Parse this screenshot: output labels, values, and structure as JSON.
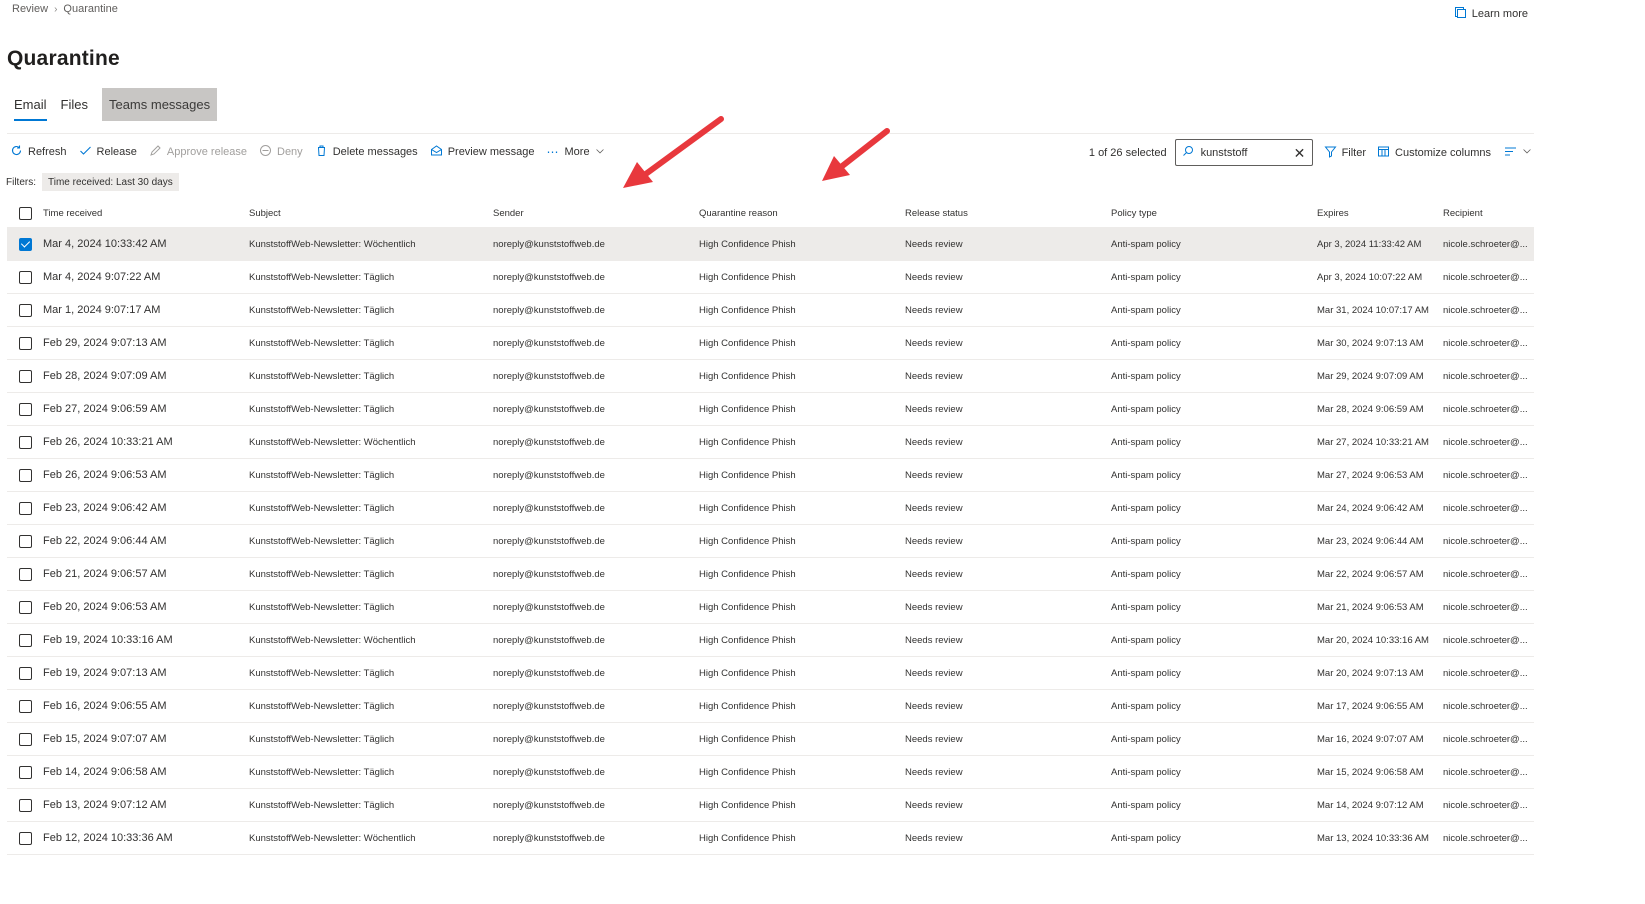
{
  "breadcrumb": {
    "items": [
      "Review",
      "Quarantine"
    ]
  },
  "header": {
    "learn_more": "Learn more"
  },
  "page_title": "Quarantine",
  "tabs": [
    {
      "label": "Email",
      "active": true
    },
    {
      "label": "Files",
      "active": false
    },
    {
      "label": "Teams messages",
      "active": false
    }
  ],
  "toolbar": {
    "refresh": "Refresh",
    "release": "Release",
    "approve_release": "Approve release",
    "deny": "Deny",
    "delete_messages": "Delete messages",
    "preview_message": "Preview message",
    "more": "More",
    "selected_count": "1 of 26 selected",
    "filter": "Filter",
    "customize_columns": "Customize columns"
  },
  "search": {
    "value": "kunststoff"
  },
  "filters": {
    "label": "Filters:",
    "chip": "Time received: Last 30 days"
  },
  "table": {
    "columns": [
      "Time received",
      "Subject",
      "Sender",
      "Quarantine reason",
      "Release status",
      "Policy type",
      "Expires",
      "Recipient"
    ],
    "rows": [
      {
        "selected": true,
        "time": "Mar 4, 2024 10:33:42 AM",
        "subject": "KunststoffWeb-Newsletter: Wöchentlich",
        "sender": "noreply@kunststoffweb.de",
        "reason": "High Confidence Phish",
        "status": "Needs review",
        "policy": "Anti-spam policy",
        "expires": "Apr 3, 2024 11:33:42 AM",
        "recipient": "nicole.schroeter@..."
      },
      {
        "selected": false,
        "time": "Mar 4, 2024 9:07:22 AM",
        "subject": "KunststoffWeb-Newsletter: Täglich",
        "sender": "noreply@kunststoffweb.de",
        "reason": "High Confidence Phish",
        "status": "Needs review",
        "policy": "Anti-spam policy",
        "expires": "Apr 3, 2024 10:07:22 AM",
        "recipient": "nicole.schroeter@..."
      },
      {
        "selected": false,
        "time": "Mar 1, 2024 9:07:17 AM",
        "subject": "KunststoffWeb-Newsletter: Täglich",
        "sender": "noreply@kunststoffweb.de",
        "reason": "High Confidence Phish",
        "status": "Needs review",
        "policy": "Anti-spam policy",
        "expires": "Mar 31, 2024 10:07:17 AM",
        "recipient": "nicole.schroeter@..."
      },
      {
        "selected": false,
        "time": "Feb 29, 2024 9:07:13 AM",
        "subject": "KunststoffWeb-Newsletter: Täglich",
        "sender": "noreply@kunststoffweb.de",
        "reason": "High Confidence Phish",
        "status": "Needs review",
        "policy": "Anti-spam policy",
        "expires": "Mar 30, 2024 9:07:13 AM",
        "recipient": "nicole.schroeter@..."
      },
      {
        "selected": false,
        "time": "Feb 28, 2024 9:07:09 AM",
        "subject": "KunststoffWeb-Newsletter: Täglich",
        "sender": "noreply@kunststoffweb.de",
        "reason": "High Confidence Phish",
        "status": "Needs review",
        "policy": "Anti-spam policy",
        "expires": "Mar 29, 2024 9:07:09 AM",
        "recipient": "nicole.schroeter@..."
      },
      {
        "selected": false,
        "time": "Feb 27, 2024 9:06:59 AM",
        "subject": "KunststoffWeb-Newsletter: Täglich",
        "sender": "noreply@kunststoffweb.de",
        "reason": "High Confidence Phish",
        "status": "Needs review",
        "policy": "Anti-spam policy",
        "expires": "Mar 28, 2024 9:06:59 AM",
        "recipient": "nicole.schroeter@..."
      },
      {
        "selected": false,
        "time": "Feb 26, 2024 10:33:21 AM",
        "subject": "KunststoffWeb-Newsletter: Wöchentlich",
        "sender": "noreply@kunststoffweb.de",
        "reason": "High Confidence Phish",
        "status": "Needs review",
        "policy": "Anti-spam policy",
        "expires": "Mar 27, 2024 10:33:21 AM",
        "recipient": "nicole.schroeter@..."
      },
      {
        "selected": false,
        "time": "Feb 26, 2024 9:06:53 AM",
        "subject": "KunststoffWeb-Newsletter: Täglich",
        "sender": "noreply@kunststoffweb.de",
        "reason": "High Confidence Phish",
        "status": "Needs review",
        "policy": "Anti-spam policy",
        "expires": "Mar 27, 2024 9:06:53 AM",
        "recipient": "nicole.schroeter@..."
      },
      {
        "selected": false,
        "time": "Feb 23, 2024 9:06:42 AM",
        "subject": "KunststoffWeb-Newsletter: Täglich",
        "sender": "noreply@kunststoffweb.de",
        "reason": "High Confidence Phish",
        "status": "Needs review",
        "policy": "Anti-spam policy",
        "expires": "Mar 24, 2024 9:06:42 AM",
        "recipient": "nicole.schroeter@..."
      },
      {
        "selected": false,
        "time": "Feb 22, 2024 9:06:44 AM",
        "subject": "KunststoffWeb-Newsletter: Täglich",
        "sender": "noreply@kunststoffweb.de",
        "reason": "High Confidence Phish",
        "status": "Needs review",
        "policy": "Anti-spam policy",
        "expires": "Mar 23, 2024 9:06:44 AM",
        "recipient": "nicole.schroeter@..."
      },
      {
        "selected": false,
        "time": "Feb 21, 2024 9:06:57 AM",
        "subject": "KunststoffWeb-Newsletter: Täglich",
        "sender": "noreply@kunststoffweb.de",
        "reason": "High Confidence Phish",
        "status": "Needs review",
        "policy": "Anti-spam policy",
        "expires": "Mar 22, 2024 9:06:57 AM",
        "recipient": "nicole.schroeter@..."
      },
      {
        "selected": false,
        "time": "Feb 20, 2024 9:06:53 AM",
        "subject": "KunststoffWeb-Newsletter: Täglich",
        "sender": "noreply@kunststoffweb.de",
        "reason": "High Confidence Phish",
        "status": "Needs review",
        "policy": "Anti-spam policy",
        "expires": "Mar 21, 2024 9:06:53 AM",
        "recipient": "nicole.schroeter@..."
      },
      {
        "selected": false,
        "time": "Feb 19, 2024 10:33:16 AM",
        "subject": "KunststoffWeb-Newsletter: Wöchentlich",
        "sender": "noreply@kunststoffweb.de",
        "reason": "High Confidence Phish",
        "status": "Needs review",
        "policy": "Anti-spam policy",
        "expires": "Mar 20, 2024 10:33:16 AM",
        "recipient": "nicole.schroeter@..."
      },
      {
        "selected": false,
        "time": "Feb 19, 2024 9:07:13 AM",
        "subject": "KunststoffWeb-Newsletter: Täglich",
        "sender": "noreply@kunststoffweb.de",
        "reason": "High Confidence Phish",
        "status": "Needs review",
        "policy": "Anti-spam policy",
        "expires": "Mar 20, 2024 9:07:13 AM",
        "recipient": "nicole.schroeter@..."
      },
      {
        "selected": false,
        "time": "Feb 16, 2024 9:06:55 AM",
        "subject": "KunststoffWeb-Newsletter: Täglich",
        "sender": "noreply@kunststoffweb.de",
        "reason": "High Confidence Phish",
        "status": "Needs review",
        "policy": "Anti-spam policy",
        "expires": "Mar 17, 2024 9:06:55 AM",
        "recipient": "nicole.schroeter@..."
      },
      {
        "selected": false,
        "time": "Feb 15, 2024 9:07:07 AM",
        "subject": "KunststoffWeb-Newsletter: Täglich",
        "sender": "noreply@kunststoffweb.de",
        "reason": "High Confidence Phish",
        "status": "Needs review",
        "policy": "Anti-spam policy",
        "expires": "Mar 16, 2024 9:07:07 AM",
        "recipient": "nicole.schroeter@..."
      },
      {
        "selected": false,
        "time": "Feb 14, 2024 9:06:58 AM",
        "subject": "KunststoffWeb-Newsletter: Täglich",
        "sender": "noreply@kunststoffweb.de",
        "reason": "High Confidence Phish",
        "status": "Needs review",
        "policy": "Anti-spam policy",
        "expires": "Mar 15, 2024 9:06:58 AM",
        "recipient": "nicole.schroeter@..."
      },
      {
        "selected": false,
        "time": "Feb 13, 2024 9:07:12 AM",
        "subject": "KunststoffWeb-Newsletter: Täglich",
        "sender": "noreply@kunststoffweb.de",
        "reason": "High Confidence Phish",
        "status": "Needs review",
        "policy": "Anti-spam policy",
        "expires": "Mar 14, 2024 9:07:12 AM",
        "recipient": "nicole.schroeter@..."
      },
      {
        "selected": false,
        "time": "Feb 12, 2024 10:33:36 AM",
        "subject": "KunststoffWeb-Newsletter: Wöchentlich",
        "sender": "noreply@kunststoffweb.de",
        "reason": "High Confidence Phish",
        "status": "Needs review",
        "policy": "Anti-spam policy",
        "expires": "Mar 13, 2024 10:33:36 AM",
        "recipient": "nicole.schroeter@..."
      }
    ]
  },
  "colors": {
    "accent": "#0078d4",
    "arrow": "#e8383d",
    "selected_row": "#edebe9"
  }
}
